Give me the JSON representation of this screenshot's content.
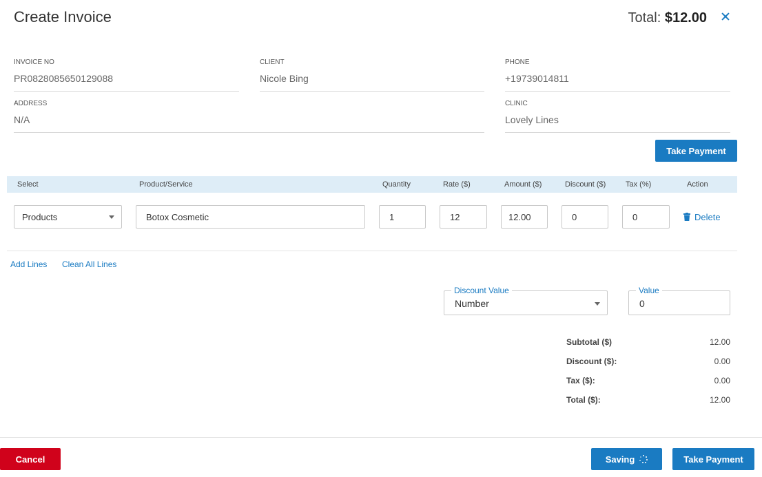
{
  "header": {
    "title": "Create Invoice",
    "total_label": "Total:",
    "total_value": "$12.00"
  },
  "fields": {
    "invoice_no": {
      "label": "INVOICE NO",
      "value": "PR0828085650129088"
    },
    "client": {
      "label": "CLIENT",
      "value": "Nicole Bing"
    },
    "phone": {
      "label": "PHONE",
      "value": "+19739014811"
    },
    "address": {
      "label": "ADDRESS",
      "value": "N/A"
    },
    "clinic": {
      "label": "CLINIC",
      "value": "Lovely Lines"
    }
  },
  "take_payment_top": "Take Payment",
  "table": {
    "headers": {
      "select": "Select",
      "product": "Product/Service",
      "quantity": "Quantity",
      "rate": "Rate ($)",
      "amount": "Amount ($)",
      "discount": "Discount ($)",
      "tax": "Tax (%)",
      "action": "Action"
    },
    "row": {
      "select": "Products",
      "product": "Botox Cosmetic",
      "quantity": "1",
      "rate": "12",
      "amount": "12.00",
      "discount": "0",
      "tax": "0",
      "delete": "Delete"
    }
  },
  "links": {
    "add_lines": "Add Lines",
    "clean_all": "Clean All Lines"
  },
  "discount": {
    "type_label": "Discount Value",
    "type_value": "Number",
    "value_label": "Value",
    "value": "0"
  },
  "summary": {
    "subtotal_label": "Subtotal ($)",
    "subtotal": "12.00",
    "discount_label": "Discount ($):",
    "discount": "0.00",
    "tax_label": "Tax ($):",
    "tax": "0.00",
    "total_label": "Total ($):",
    "total": "12.00"
  },
  "footer": {
    "cancel": "Cancel",
    "saving": "Saving",
    "take_payment": "Take Payment"
  },
  "colors": {
    "accent": "#1a7bc2",
    "danger": "#d0021b",
    "table_header_bg": "#deedf7"
  }
}
